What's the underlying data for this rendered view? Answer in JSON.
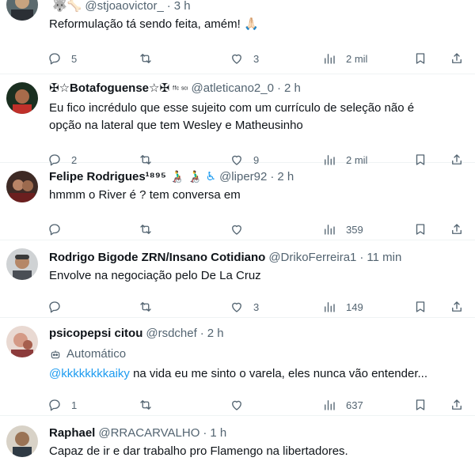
{
  "tweets": [
    {
      "name": "",
      "name_extra": "🐺🦴",
      "handle": "@stjoaovictor_",
      "time": "3 h",
      "text": "Reformulação tá sendo feita, amém! 🙏🏻",
      "replies": "5",
      "retweets": "",
      "likes": "3",
      "views": "2 mil"
    },
    {
      "name": "✠☆Botafoguense☆✠",
      "name_extra": "ᶠᶠᶜ ˢᶜᶦ",
      "handle": "@atleticano2_0",
      "time": "2 h",
      "text": "Eu fico incrédulo que esse sujeito com um currículo de seleção não é opção na lateral que tem Wesley e Matheusinho",
      "replies": "2",
      "retweets": "",
      "likes": "9",
      "views": "2 mil"
    },
    {
      "name": "Felipe Rodrigues¹⁸⁹⁵",
      "name_extra": "👨‍🦽 👨‍🦽 ♿",
      "handle": "@liper92",
      "time": "2 h",
      "text": "hmmm o River é ? tem conversa em",
      "replies": "",
      "retweets": "",
      "likes": "",
      "views": "359"
    },
    {
      "name": "Rodrigo Bigode ZRN/Insano Cotidiano",
      "name_extra": "",
      "handle": "@DrikoFerreira1",
      "time": "11 min",
      "text": "Envolve na negociação pelo De La Cruz",
      "replies": "",
      "retweets": "",
      "likes": "3",
      "views": "149"
    },
    {
      "name": "psicopepsi citou",
      "name_extra": "",
      "handle": "@rsdchef",
      "time": "2 h",
      "automated": "Automático",
      "mention": "@kkkkkkkkaiky",
      "text": " na vida eu me sinto o varela, eles nunca vão entender...",
      "replies": "1",
      "retweets": "",
      "likes": "",
      "views": "637"
    },
    {
      "name": "Raphael",
      "name_extra": "",
      "handle": "@RRACARVALHO",
      "time": "1 h",
      "text": "Capaz de ir e dar trabalho pro Flamengo na libertadores."
    }
  ],
  "separator": "·",
  "colors": {
    "text": "#0f1419",
    "secondary": "#536471",
    "link": "#1d9bf0",
    "divider": "#eff3f4"
  },
  "icons": [
    "reply-icon",
    "retweet-icon",
    "like-icon",
    "views-icon",
    "bookmark-icon",
    "share-icon",
    "robot-icon"
  ]
}
